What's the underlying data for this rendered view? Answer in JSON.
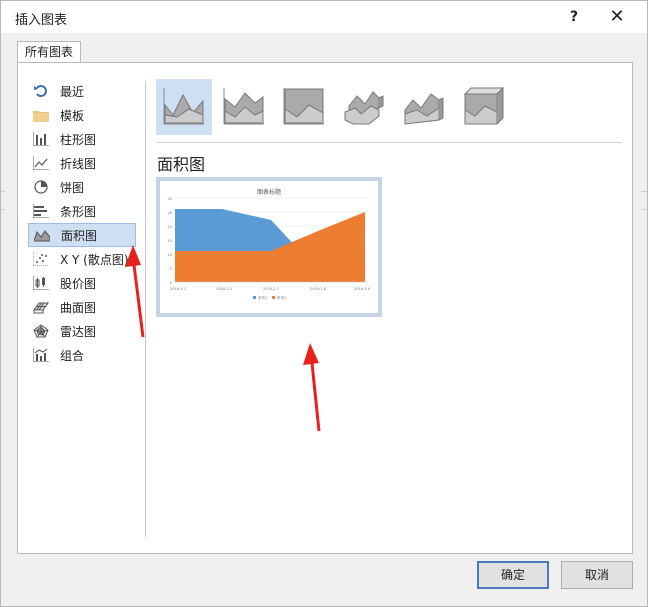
{
  "dialog": {
    "title": "插入图表",
    "help": "?",
    "close": "✕"
  },
  "tabs": [
    {
      "label": "所有图表"
    }
  ],
  "categories": [
    {
      "label": "最近",
      "icon": "recent-icon"
    },
    {
      "label": "模板",
      "icon": "folder-icon"
    },
    {
      "label": "柱形图",
      "icon": "column-chart-icon"
    },
    {
      "label": "折线图",
      "icon": "line-chart-icon"
    },
    {
      "label": "饼图",
      "icon": "pie-chart-icon"
    },
    {
      "label": "条形图",
      "icon": "bar-chart-icon"
    },
    {
      "label": "面积图",
      "icon": "area-chart-icon",
      "selected": true
    },
    {
      "label": "X Y (散点图)",
      "icon": "scatter-chart-icon"
    },
    {
      "label": "股价图",
      "icon": "stock-chart-icon"
    },
    {
      "label": "曲面图",
      "icon": "surface-chart-icon"
    },
    {
      "label": "雷达图",
      "icon": "radar-chart-icon"
    },
    {
      "label": "组合",
      "icon": "combo-chart-icon"
    }
  ],
  "subtypes": [
    {
      "icon": "area-subtype-icon",
      "selected": true
    },
    {
      "icon": "stacked-area-subtype-icon"
    },
    {
      "icon": "percent-stacked-area-subtype-icon"
    },
    {
      "icon": "3d-area-subtype-icon"
    },
    {
      "icon": "3d-stacked-area-subtype-icon"
    },
    {
      "icon": "3d-percent-area-subtype-icon"
    }
  ],
  "section_title": "面积图",
  "preview": {
    "title": "图表标题",
    "y_ticks": [
      "0",
      "5",
      "10",
      "15",
      "20",
      "25",
      "30"
    ],
    "x_ticks": [
      "2019-1-1",
      "2019-1-5",
      "2019-1-7",
      "2019-1-8",
      "2019-1-9"
    ],
    "legend": [
      "系列1",
      "系列2"
    ],
    "colors": {
      "series1": "#5b9bd5",
      "series2": "#ed7d31"
    }
  },
  "buttons": {
    "ok": "确定",
    "cancel": "取消"
  },
  "colors": {
    "selected_bg": "#cfdff3",
    "annotation_arrow": "#e8211d"
  }
}
